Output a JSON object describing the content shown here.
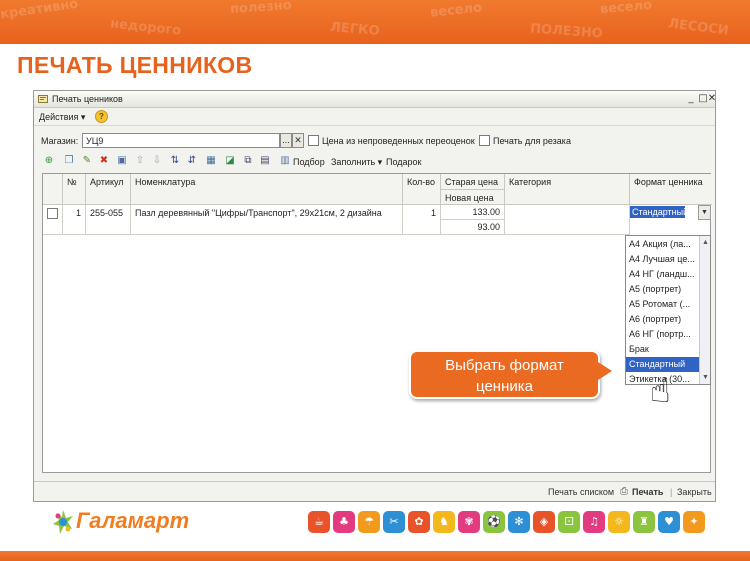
{
  "slide": {
    "title": "ПЕЧАТЬ ЦЕННИКОВ",
    "banner_words": [
      "креативно",
      "недорого",
      "полезно",
      "ЛЕГКО",
      "весело",
      "ПОЛЕЗНО",
      "весело",
      "ЛЕСОСИ"
    ]
  },
  "window": {
    "title": "Печать ценников",
    "controls": {
      "minimize": "_",
      "maximize": "□",
      "close": "✕"
    }
  },
  "menu": {
    "actions_label": "Действия ▾",
    "help_label": "?"
  },
  "shop": {
    "label": "Магазин:",
    "value": "УЦ9",
    "select_button": "...",
    "clear_button": "✕",
    "checkbox_unposted_label": "Цена из непроведенных переоценок",
    "checkbox_cutter_label": "Печать для резака"
  },
  "toolbar": {
    "selection_label": "Подбор",
    "fill_label": "Заполнить ▾",
    "gift_label": "Подарок"
  },
  "table": {
    "headers": {
      "num": "№",
      "article": "Артикул",
      "nomenclature": "Номенклатура",
      "qty": "Кол-во",
      "old_price": "Старая цена",
      "new_price": "Новая цена",
      "category": "Категория",
      "format": "Формат ценника"
    },
    "rows": [
      {
        "num": "1",
        "article": "255-055",
        "nomenclature": "Пазл деревянный \"Цифры/Транспорт\", 29x21см, 2 дизайна",
        "qty": "1",
        "old_price": "133.00",
        "new_price": "93.00",
        "category": "",
        "format": "Стандартный"
      }
    ]
  },
  "dropdown": {
    "items": [
      "А4 Акция (ла...",
      "А4 Лучшая це...",
      "А4 НГ (ландш...",
      "А5 (портрет)",
      "А5 Ротомат (...",
      "А6 (портрет)",
      "А6 НГ (портр...",
      "Брак",
      "Стандартный",
      "Этикетка (30..."
    ],
    "selected": "Стандартный"
  },
  "status": {
    "print_list": "Печать списком",
    "print": "Печать",
    "close": "Закрыть"
  },
  "callout": {
    "line1": "Выбрать формат",
    "line2": "ценника"
  },
  "footer": {
    "logo_text": "Галамарт",
    "category_colors": [
      "#e8532a",
      "#e23b80",
      "#f29a1c",
      "#2d8fd4",
      "#e8532a",
      "#f2b81c",
      "#e23b80",
      "#8bc53f",
      "#2d8fd4",
      "#e8532a",
      "#8bc53f",
      "#e23b80",
      "#f2b81c",
      "#8bc53f",
      "#2d8fd4",
      "#f29a1c"
    ],
    "category_icons": [
      "☕",
      "♣",
      "☂",
      "✂",
      "✿",
      "♞",
      "✾",
      "⚽",
      "✻",
      "◈",
      "⚀",
      "♫",
      "☼",
      "♜",
      "♥",
      "✦"
    ]
  }
}
